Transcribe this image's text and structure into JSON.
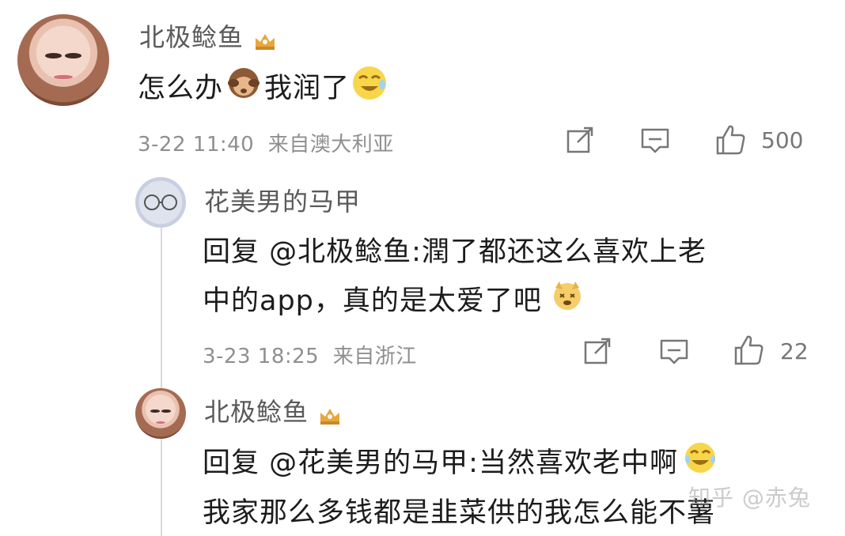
{
  "comments": [
    {
      "username": "北极鲶鱼",
      "content_a": "怎么办",
      "content_b": "我润了",
      "date": "3-22 11:40",
      "location": "来自澳大利亚",
      "like_count": "500"
    },
    {
      "username": "花美男的马甲",
      "reply_prefix": "回复",
      "mention": "@北极鲶鱼",
      "line1": ":潤了都还这么喜欢上老",
      "line2": "中的app，真的是太爱了吧",
      "date": "3-23 18:25",
      "location": "来自浙江",
      "like_count": "22"
    },
    {
      "username": "北极鲶鱼",
      "reply_prefix": "回复",
      "mention": "@花美男的马甲",
      "line1": ":当然喜欢老中啊",
      "line2": "我家那么多钱都是韭菜供的我怎么能不薯"
    }
  ],
  "watermark": "知乎 @赤兔",
  "colors": {
    "username": "#5a5a5a",
    "meta": "#8f8f8f",
    "thread_line": "#d9d9d9",
    "crown": "#e9a63a"
  },
  "icons": [
    "crown-icon",
    "monkey-emoji-icon",
    "laughing-emoji-icon",
    "dog-emoji-icon",
    "share-icon",
    "comment-icon",
    "like-icon"
  ]
}
